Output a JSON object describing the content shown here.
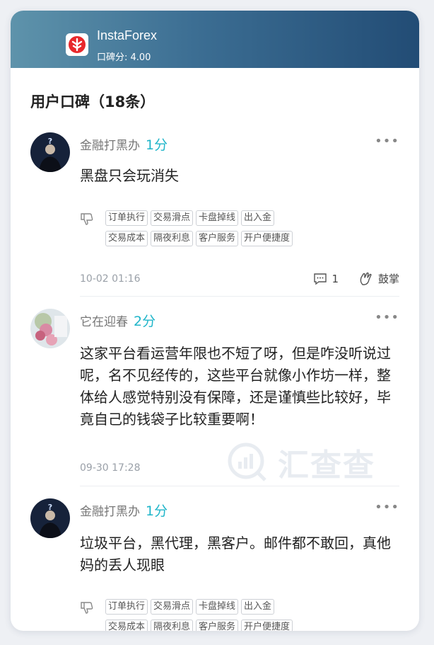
{
  "broker": {
    "name": "InstaForex",
    "rating_text": "口碑分: 4.00",
    "logo_icon": "red-gear-tree-logo"
  },
  "section_title": "用户口碑（18条）",
  "tags_row1": [
    "订单执行",
    "交易滑点",
    "卡盘掉线",
    "出入金"
  ],
  "tags_row2": [
    "交易成本",
    "隔夜利息",
    "客户服务",
    "开户便捷度"
  ],
  "reviews": [
    {
      "author": "金融打黑办",
      "score": "1分",
      "content": "黑盘只会玩消失",
      "time": "10-02 01:16",
      "comment_count": "1",
      "applaud_label": "鼓掌"
    },
    {
      "author": "它在迎春",
      "score": "2分",
      "content": "这家平台看运营年限也不短了呀，但是咋没听说过呢，名不见经传的，这些平台就像小作坊一样，整体给人感觉特别没有保障，还是谨慎些比较好，毕竟自己的钱袋子比较重要啊！",
      "time": "09-30 17:28"
    },
    {
      "author": "金融打黑办",
      "score": "1分",
      "content": "垃圾平台，黑代理，黑客户。邮件都不敢回，真他妈的丢人现眼"
    }
  ],
  "more_icon": "•••",
  "watermark": "汇查查",
  "colors": {
    "accent": "#1fb5c9",
    "header_start": "#5e93ab",
    "header_end": "#224c75"
  }
}
